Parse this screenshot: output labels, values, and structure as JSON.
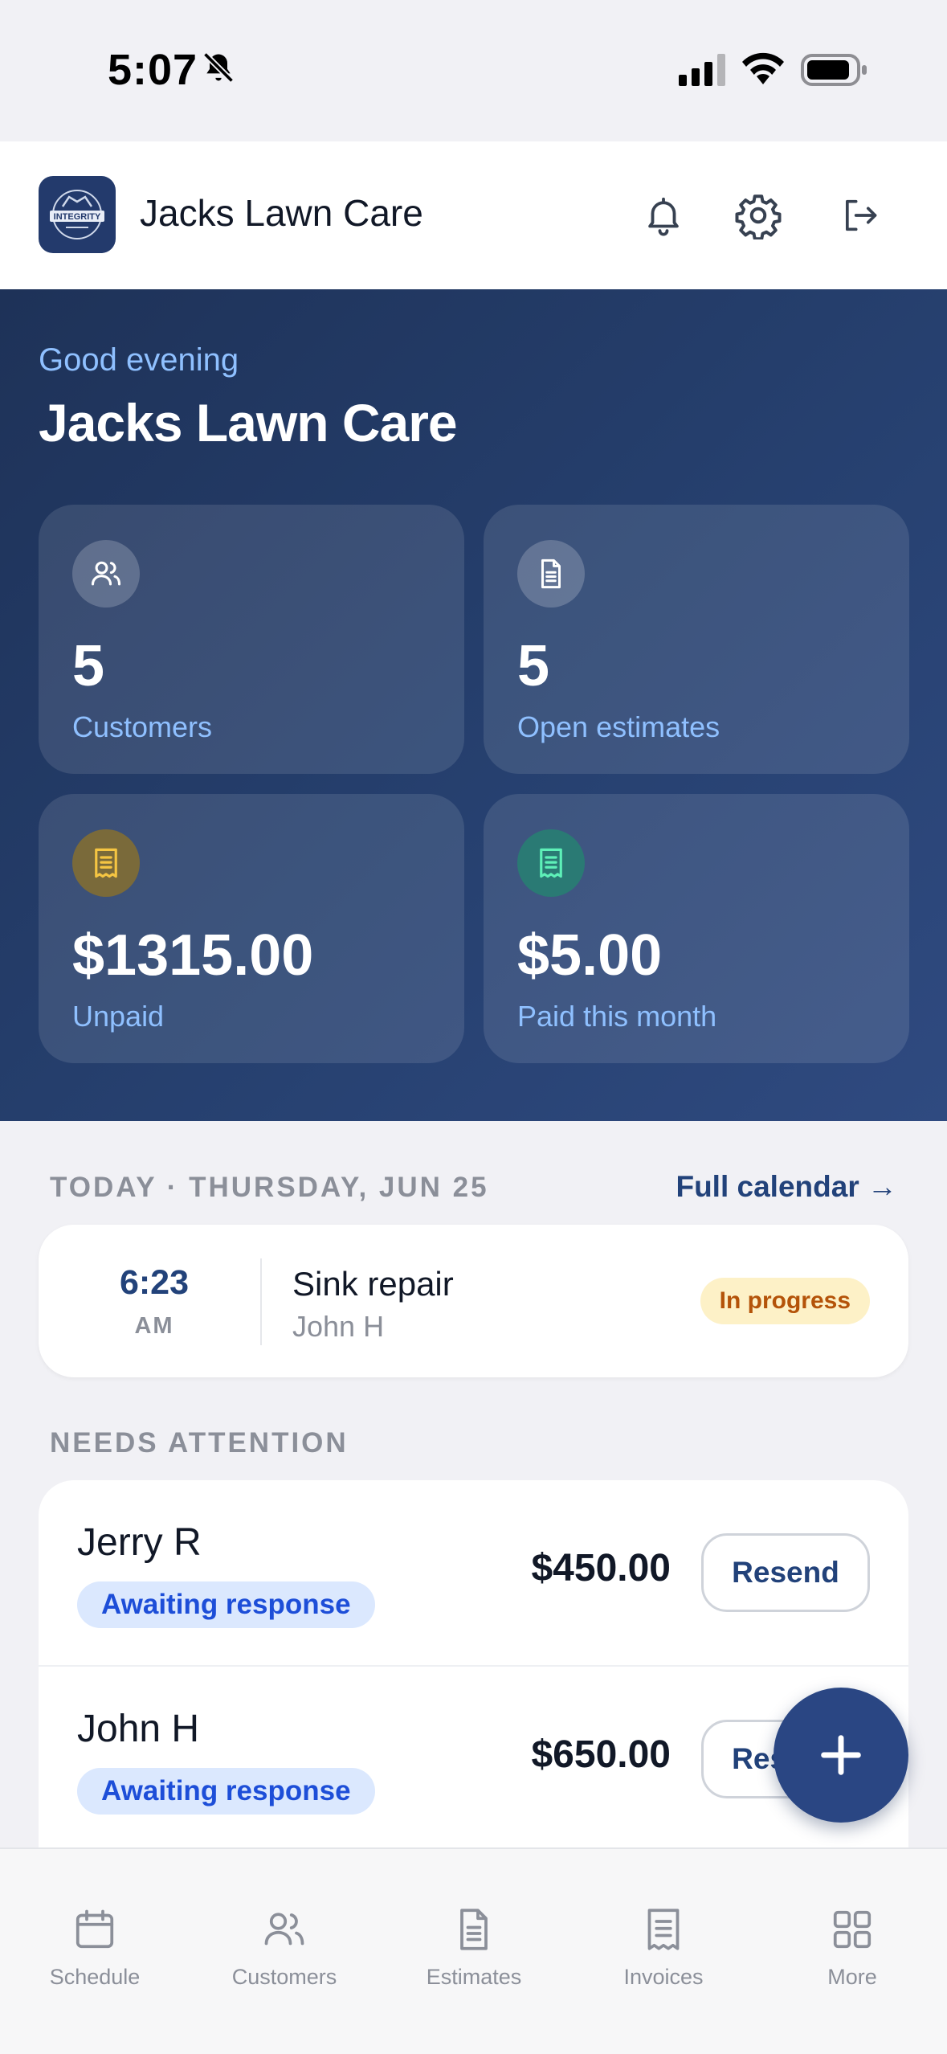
{
  "status_bar": {
    "time": "5:07"
  },
  "header": {
    "app_name": "Jacks Lawn Care",
    "logo_text": "INTEGRITY"
  },
  "hero": {
    "greeting": "Good evening",
    "business_name": "Jacks Lawn Care",
    "stats": [
      {
        "value": "5",
        "label": "Customers",
        "icon": "users-icon"
      },
      {
        "value": "5",
        "label": "Open estimates",
        "icon": "document-icon"
      },
      {
        "value": "$1315.00",
        "label": "Unpaid",
        "icon": "receipt-icon"
      },
      {
        "value": "$5.00",
        "label": "Paid this month",
        "icon": "receipt-icon"
      }
    ]
  },
  "today": {
    "heading": "TODAY · THURSDAY, JUN 25",
    "calendar_link": "Full calendar →",
    "appointment": {
      "time": "6:23",
      "ampm": "AM",
      "title": "Sink repair",
      "customer": "John H",
      "status": "In progress"
    }
  },
  "attention": {
    "heading": "NEEDS ATTENTION",
    "items": [
      {
        "name": "Jerry R",
        "status": "Awaiting response",
        "amount": "$450.00",
        "action": "Resend"
      },
      {
        "name": "John H",
        "status": "Awaiting response",
        "amount": "$650.00",
        "action": "Resend"
      }
    ]
  },
  "tabs": [
    {
      "label": "Schedule",
      "icon": "calendar-icon"
    },
    {
      "label": "Customers",
      "icon": "users-icon"
    },
    {
      "label": "Estimates",
      "icon": "document-icon"
    },
    {
      "label": "Invoices",
      "icon": "receipt-icon"
    },
    {
      "label": "More",
      "icon": "grid-icon"
    }
  ],
  "colors": {
    "brand": "#22427a",
    "hero_start": "#1e3258",
    "hero_end": "#2f4a80",
    "accent_light": "#8fc0ff",
    "in_progress_bg": "#fdf1c7",
    "in_progress_text": "#b45309",
    "awaiting_bg": "#dbe8fe",
    "awaiting_text": "#1d4ed8"
  }
}
